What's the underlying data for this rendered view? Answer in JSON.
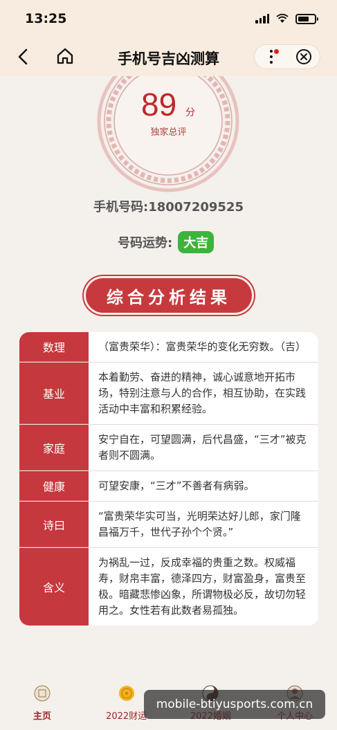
{
  "status_bar": {
    "time": "13:25"
  },
  "nav": {
    "title": "手机号吉凶测算"
  },
  "score": {
    "value": "89",
    "unit": "分",
    "caption": "独家总评"
  },
  "phone": {
    "text": "手机号码:18007209525"
  },
  "fortune": {
    "label": "号码运势:",
    "badge": "大吉",
    "badge_color": "#3cb43c"
  },
  "section": {
    "title": "综合分析结果"
  },
  "results": [
    {
      "label": "数理",
      "text": "（富贵荣华）：富贵荣华的变化无穷数。（吉）"
    },
    {
      "label": "基业",
      "text": "本着勤劳、奋进的精神，诚心诚意地开拓市场，特别注意与人的合作，相互协助，在实践活动中丰富和积累经验。"
    },
    {
      "label": "家庭",
      "text": "安宁自在，可望圆满，后代昌盛，“三才”被克者则不圆满。"
    },
    {
      "label": "健康",
      "text": "可望安康，“三才”不善者有病弱。"
    },
    {
      "label": "诗曰",
      "text": "“富贵荣华实可当，光明荣达好儿郎，家门隆昌福万千，世代子孙个个贤。”"
    },
    {
      "label": "含义",
      "text": "为祸乱一过，反成幸福的贵重之数。权威福寿，财帛丰富，德泽四方，财富盈身，富贵至极。暗藏悲惨凶象，所谓物极必反，故切勿轻用之。女性若有此数者易孤独。"
    }
  ],
  "tabs": [
    {
      "label": "主页",
      "icon": "home-seal-icon"
    },
    {
      "label": "2022财运",
      "icon": "coin-icon"
    },
    {
      "label": "2022婚姻",
      "icon": "yin-yang-icon"
    },
    {
      "label": "个人中心",
      "icon": "user-icon"
    }
  ],
  "watermark": {
    "text": "mobile-btiyusports.com.cn"
  },
  "colors": {
    "accent": "#c5383d",
    "header_bg": "#f7ecdf",
    "badge": "#3cb43c"
  }
}
